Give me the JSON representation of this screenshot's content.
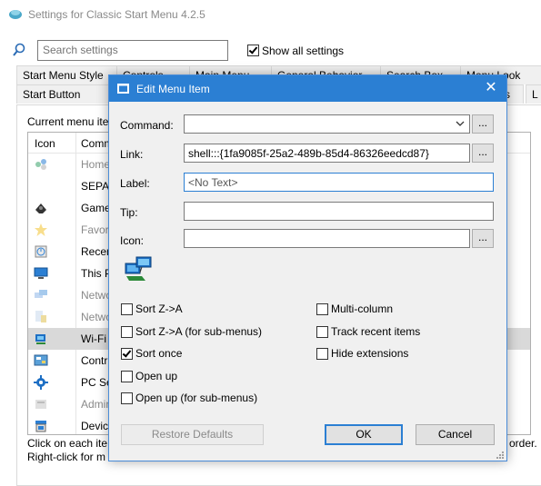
{
  "app": {
    "title": "Settings for Classic Start Menu 4.2.5"
  },
  "search": {
    "placeholder": "Search settings",
    "show_all_label": "Show all settings",
    "show_all_checked": true
  },
  "tabs_row1": [
    "Start Menu Style",
    "Controls",
    "Main Menu",
    "General Behavior",
    "Search Box",
    "Menu Look"
  ],
  "tabs_row2": [
    "Start Button",
    "s",
    "L"
  ],
  "panel": {
    "current_menu_label": "Current menu ite",
    "columns": [
      "Icon",
      "Comm"
    ],
    "rows": [
      {
        "text": "Home",
        "icon": "homegroup-icon",
        "dim": true
      },
      {
        "text": "SEPAR",
        "icon": "",
        "dim": false
      },
      {
        "text": "Game",
        "icon": "games-icon",
        "dim": false
      },
      {
        "text": "Favori",
        "icon": "favorites-star-icon",
        "dim": true
      },
      {
        "text": "Recen",
        "icon": "recent-items-icon",
        "dim": false
      },
      {
        "text": "This P",
        "icon": "computer-monitor-icon",
        "dim": false
      },
      {
        "text": "Netwo",
        "icon": "network-icon",
        "dim": true
      },
      {
        "text": "Netwo",
        "icon": "network-connections-icon",
        "dim": true
      },
      {
        "text": "Wi-Fi",
        "icon": "wifi-network-icon",
        "dim": false,
        "selected": true
      },
      {
        "text": "Contr",
        "icon": "control-panel-icon",
        "dim": false
      },
      {
        "text": "PC Se",
        "icon": "gear-icon",
        "dim": false
      },
      {
        "text": "Admin",
        "icon": "admin-tools-icon",
        "dim": true
      },
      {
        "text": "Device",
        "icon": "devices-icon",
        "dim": false
      }
    ],
    "hint1": "Click on each ite",
    "hint2": "Right-click for m",
    "hint_right": "order."
  },
  "dialog": {
    "title": "Edit Menu Item",
    "command_label": "Command:",
    "command_value": "",
    "link_label": "Link:",
    "link_value": "shell:::{1fa9085f-25a2-489b-85d4-86326eedcd87}",
    "label_label": "Label:",
    "label_value": "<No Text>",
    "tip_label": "Tip:",
    "tip_value": "",
    "icon_label": "Icon:",
    "icon_value": "",
    "browse_label": "...",
    "checkboxes_left": [
      {
        "label": "Sort Z->A",
        "checked": false
      },
      {
        "label": "Sort Z->A (for sub-menus)",
        "checked": false
      },
      {
        "label": "Sort once",
        "checked": true
      },
      {
        "label": "Open up",
        "checked": false
      },
      {
        "label": "Open up (for sub-menus)",
        "checked": false
      }
    ],
    "checkboxes_right": [
      {
        "label": "Multi-column",
        "checked": false
      },
      {
        "label": "Track recent items",
        "checked": false
      },
      {
        "label": "Hide extensions",
        "checked": false
      }
    ],
    "restore_label": "Restore Defaults",
    "ok_label": "OK",
    "cancel_label": "Cancel"
  },
  "colors": {
    "accent": "#2b7fd3",
    "title_text": "#ffffff",
    "disabled_text": "#8a8a8a"
  }
}
